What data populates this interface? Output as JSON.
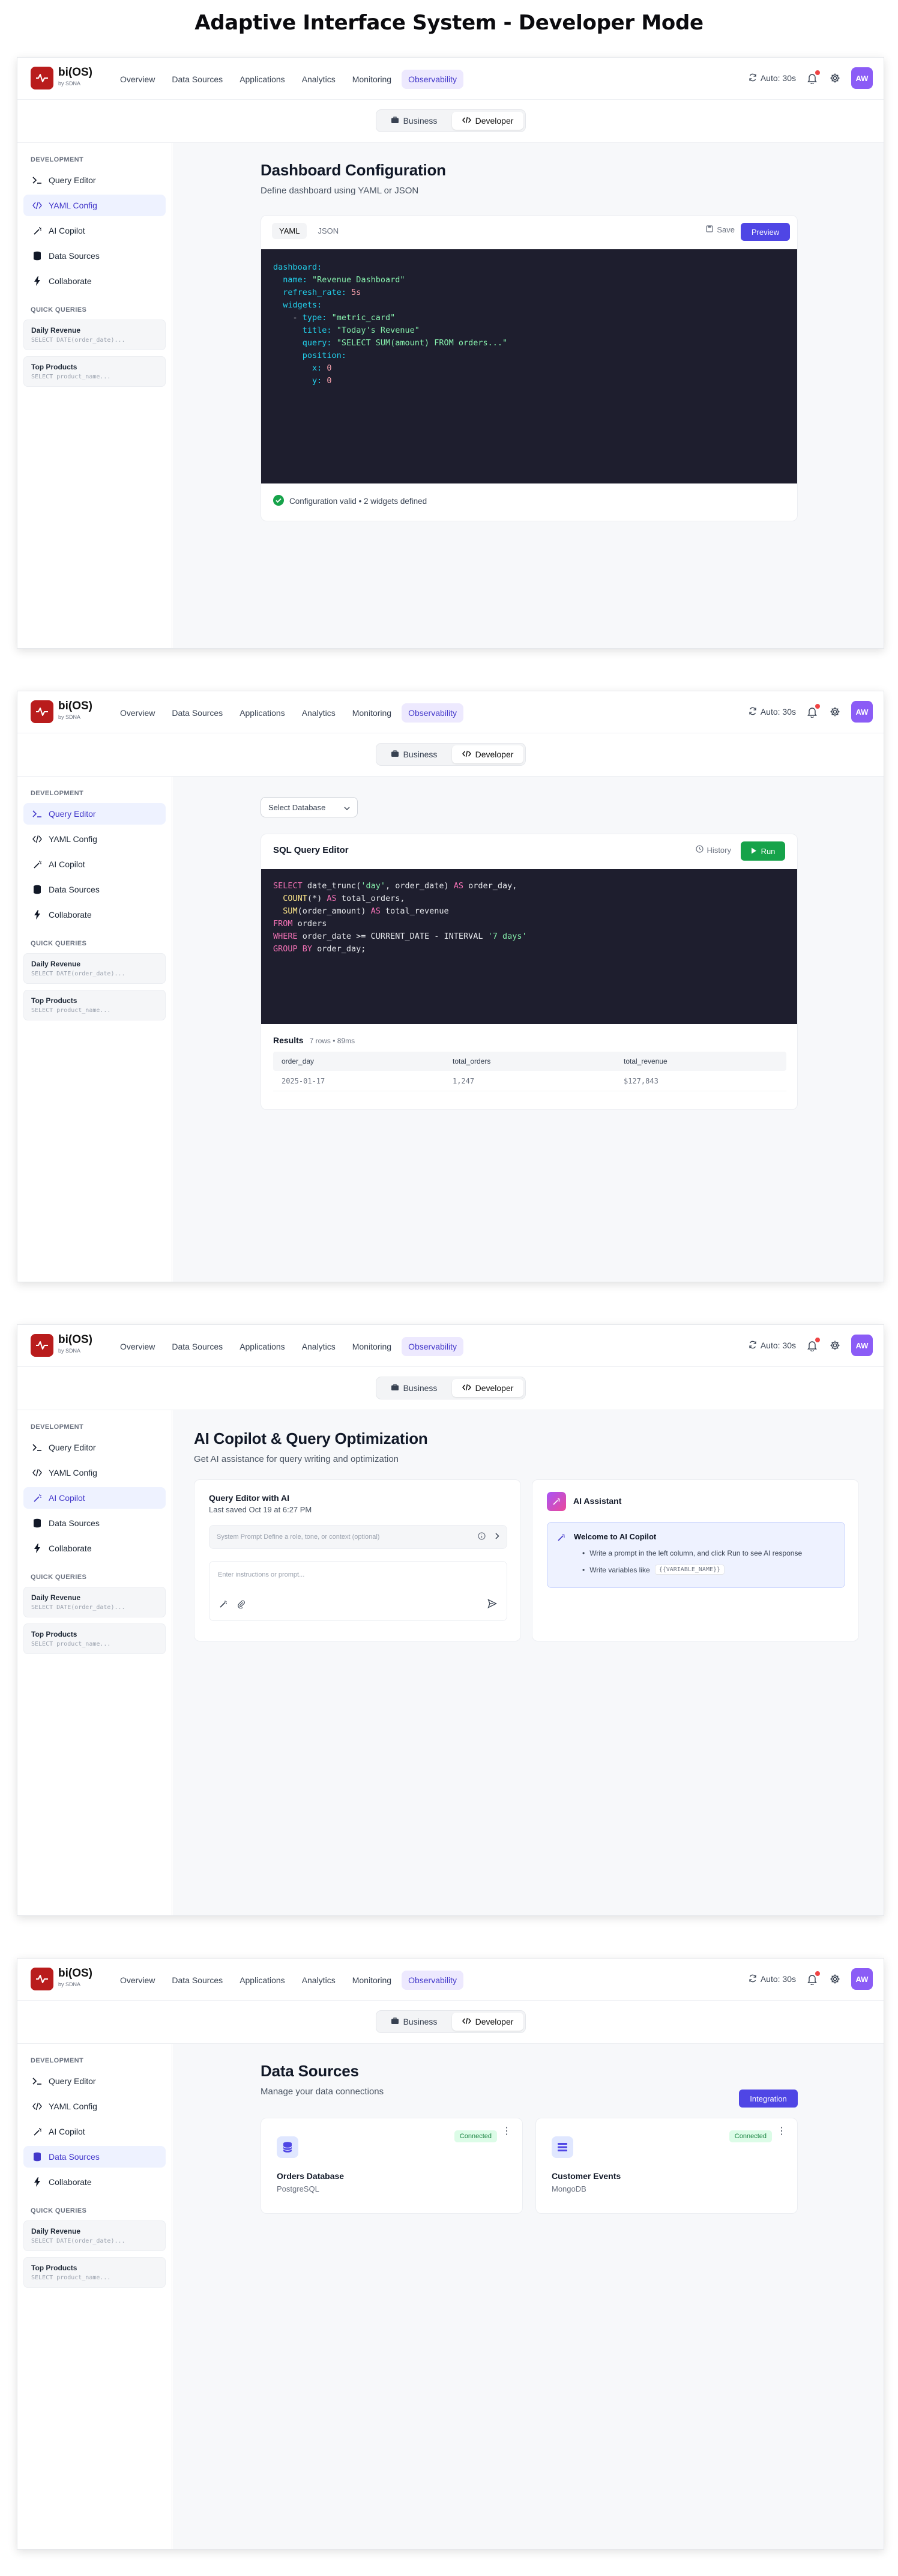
{
  "page_title": "Adaptive Interface System - Developer Mode",
  "topbar": {
    "logo_name": "bi(OS)",
    "logo_sub": "by SDNA",
    "nav": [
      "Overview",
      "Data Sources",
      "Applications",
      "Analytics",
      "Monitoring",
      "Observability"
    ],
    "active_nav": "Observability",
    "auto_label": "Auto: 30s",
    "avatar": "AW"
  },
  "toggle": {
    "business": "Business",
    "developer": "Developer"
  },
  "sidebar": {
    "dev_heading": "DEVELOPMENT",
    "items": [
      "Query Editor",
      "YAML Config",
      "AI Copilot",
      "Data Sources",
      "Collaborate"
    ],
    "quick_heading": "QUICK QUERIES",
    "queries": [
      {
        "title": "Daily Revenue",
        "sql": "SELECT DATE(order_date)..."
      },
      {
        "title": "Top Products",
        "sql": "SELECT product_name..."
      }
    ]
  },
  "yaml_screen": {
    "title": "Dashboard Configuration",
    "subtitle": "Define dashboard using YAML or JSON",
    "tab_yaml": "YAML",
    "tab_json": "JSON",
    "save": "Save",
    "preview": "Preview",
    "status": "Configuration valid • 2 widgets defined"
  },
  "query_screen": {
    "select_db": "Select Database",
    "editor_title": "SQL Query Editor",
    "history": "History",
    "run": "Run",
    "results_label": "Results",
    "results_meta": "7 rows • 89ms",
    "columns": [
      "order_day",
      "total_orders",
      "total_revenue"
    ],
    "row": [
      "2025-01-17",
      "1,247",
      "$127,843"
    ]
  },
  "copilot_screen": {
    "title": "AI Copilot & Query Optimization",
    "subtitle": "Get AI assistance for query writing and optimization",
    "editor_title": "Query Editor with AI",
    "saved": "Last saved Oct 19 at 6:27 PM",
    "system_prompt_placeholder": "System Prompt Define a role, tone, or context (optional)",
    "instructions_placeholder": "Enter instructions or prompt...",
    "assistant_title": "AI Assistant",
    "welcome_title": "Welcome to AI Copilot",
    "bullet1": "Write a prompt in the left column, and click Run to see AI response",
    "bullet2_prefix": "Write variables like",
    "bullet2_code": "{{VARIABLE_NAME}}"
  },
  "sources_screen": {
    "title": "Data Sources",
    "subtitle": "Manage your data connections",
    "integration": "Integration",
    "sources": [
      {
        "name": "Orders Database",
        "type": "PostgreSQL",
        "status": "Connected"
      },
      {
        "name": "Customer Events",
        "type": "MongoDB",
        "status": "Connected"
      }
    ]
  },
  "colors": {
    "accent": "#4f46e5",
    "brand": "#b91c1c",
    "success": "#16a34a",
    "code_bg": "#1e1e2e"
  }
}
